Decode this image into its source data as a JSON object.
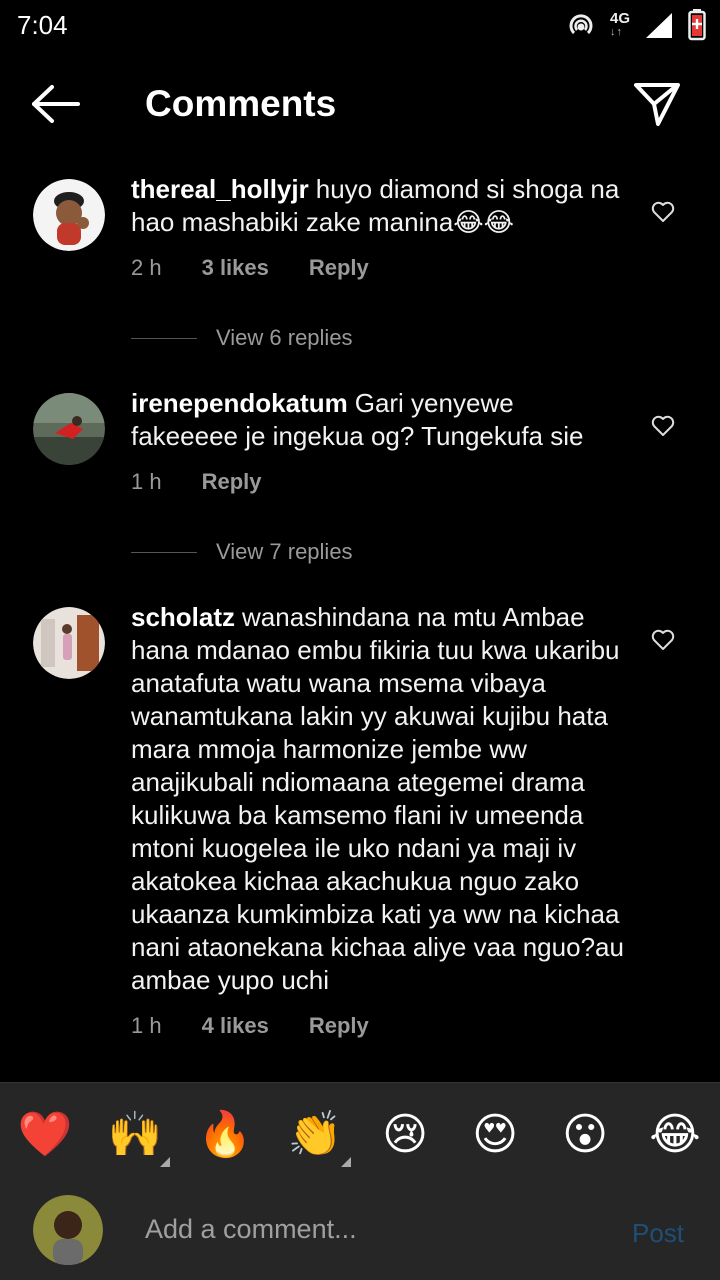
{
  "status_bar": {
    "time": "7:04",
    "network": "4G"
  },
  "header": {
    "title": "Comments"
  },
  "comments": [
    {
      "username": "thereal_hollyjr",
      "text": "huyo diamond si shoga na hao mashabiki zake manina😂😂",
      "time": "2 h",
      "likes": "3 likes",
      "reply": "Reply",
      "view_replies": "View 6 replies"
    },
    {
      "username": "irenependokatum",
      "text": "Gari yenyewe fakeeeee je ingekua og?  Tungekufa sie",
      "time": "1 h",
      "likes": "",
      "reply": "Reply",
      "view_replies": "View 7 replies"
    },
    {
      "username": "scholatz",
      "text": "wanashindana na mtu Ambae hana mdanao embu fikiria tuu kwa ukaribu anatafuta watu wana msema vibaya wanamtukana lakin yy akuwai kujibu hata mara mmoja harmonize jembe ww anajikubali ndiomaana ategemei drama kulikuwa ba kamsemo flani iv umeenda mtoni kuogelea  ile uko ndani ya maji iv akatokea kichaa akachukua nguo zako ukaanza kumkimbiza kati ya ww na kichaa nani ataonekana kichaa aliye vaa nguo?au ambae yupo uchi",
      "time": "1 h",
      "likes": "4 likes",
      "reply": "Reply",
      "view_replies": ""
    }
  ],
  "reactions": [
    "❤️",
    "🙌",
    "🔥",
    "👏",
    "😢",
    "😍",
    "😮",
    "😂"
  ],
  "composer": {
    "placeholder": "Add a comment...",
    "post_label": "Post"
  },
  "colors": {
    "background": "#000000",
    "bar": "#262626",
    "post_disabled": "#1d4f79",
    "muted": "#9a9a9a"
  }
}
